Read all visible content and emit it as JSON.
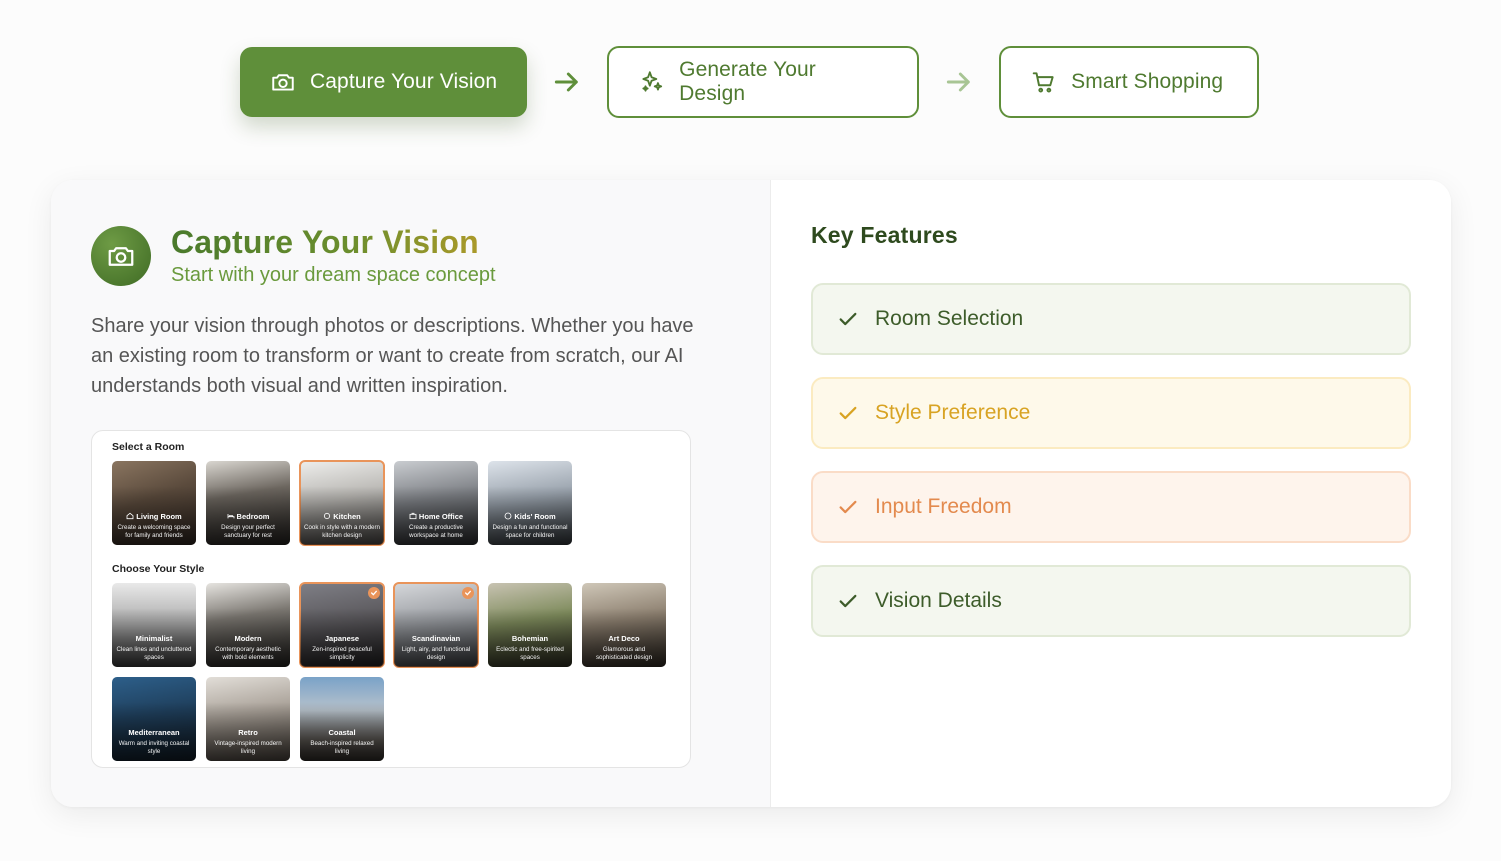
{
  "stepper": {
    "steps": [
      {
        "label": "Capture Your Vision",
        "icon": "camera-icon",
        "state": "active"
      },
      {
        "label": "Generate Your Design",
        "icon": "sparkles-icon",
        "state": "upcoming"
      },
      {
        "label": "Smart Shopping",
        "icon": "cart-icon",
        "state": "upcoming"
      }
    ]
  },
  "section": {
    "title": "Capture Your Vision",
    "subtitle": "Start with your dream space concept",
    "description": "Share your vision through photos or descriptions. Whether you have an existing room to transform or want to create from scratch, our AI understands both visual and written inspiration."
  },
  "selector": {
    "room_label": "Select a Room",
    "rooms": [
      {
        "name": "Living Room",
        "desc": "Create a welcoming space for family and friends",
        "icon": "home-icon",
        "selected": false
      },
      {
        "name": "Bedroom",
        "desc": "Design your perfect sanctuary for rest",
        "icon": "bed-icon",
        "selected": false
      },
      {
        "name": "Kitchen",
        "desc": "Cook in style with a modern kitchen design",
        "icon": "utensils-icon",
        "selected": true
      },
      {
        "name": "Home Office",
        "desc": "Create a productive workspace at home",
        "icon": "briefcase-icon",
        "selected": false
      },
      {
        "name": "Kids' Room",
        "desc": "Design a fun and functional space for children",
        "icon": "smile-icon",
        "selected": false
      }
    ],
    "style_label": "Choose Your Style",
    "styles": [
      {
        "name": "Minimalist",
        "desc": "Clean lines and uncluttered spaces",
        "selected": false
      },
      {
        "name": "Modern",
        "desc": "Contemporary aesthetic with bold elements",
        "selected": false
      },
      {
        "name": "Japanese",
        "desc": "Zen-inspired peaceful simplicity",
        "selected": true
      },
      {
        "name": "Scandinavian",
        "desc": "Light, airy, and functional design",
        "selected": true
      },
      {
        "name": "Bohemian",
        "desc": "Eclectic and free-spirited spaces",
        "selected": false
      },
      {
        "name": "Art Deco",
        "desc": "Glamorous and sophisticated design",
        "selected": false
      },
      {
        "name": "Mediterranean",
        "desc": "Warm and inviting coastal style",
        "selected": false
      },
      {
        "name": "Retro",
        "desc": "Vintage-inspired modern living",
        "selected": false
      },
      {
        "name": "Coastal",
        "desc": "Beach-inspired relaxed living",
        "selected": false
      }
    ]
  },
  "features": {
    "title": "Key Features",
    "items": [
      {
        "label": "Room Selection",
        "tone": "green"
      },
      {
        "label": "Style Preference",
        "tone": "yellow"
      },
      {
        "label": "Input Freedom",
        "tone": "peach"
      },
      {
        "label": "Vision Details",
        "tone": "green"
      }
    ]
  },
  "colors": {
    "primary": "#5f8f3a",
    "accent_orange": "#e9945a",
    "feature_yellow": "#d8a323",
    "feature_peach": "#e38a4e"
  }
}
